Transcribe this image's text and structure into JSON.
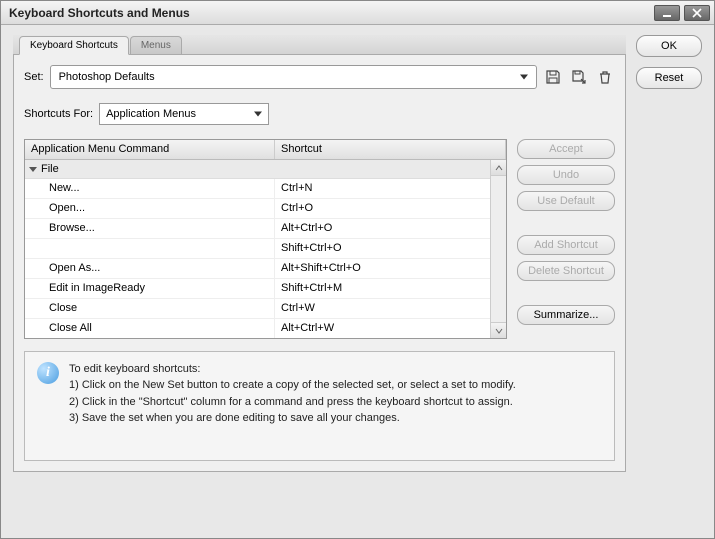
{
  "title": "Keyboard Shortcuts and Menus",
  "dialog": {
    "ok": "OK",
    "reset": "Reset"
  },
  "tabs": {
    "shortcuts": "Keyboard Shortcuts",
    "menus": "Menus"
  },
  "set": {
    "label": "Set:",
    "value": "Photoshop Defaults"
  },
  "shortcuts_for": {
    "label": "Shortcuts For:",
    "value": "Application Menus"
  },
  "table": {
    "headers": {
      "command": "Application Menu Command",
      "shortcut": "Shortcut"
    },
    "group": "File",
    "rows": [
      {
        "cmd": "New...",
        "sc": "Ctrl+N"
      },
      {
        "cmd": "Open...",
        "sc": "Ctrl+O"
      },
      {
        "cmd": "Browse...",
        "sc": "Alt+Ctrl+O"
      },
      {
        "cmd": "",
        "sc": "Shift+Ctrl+O"
      },
      {
        "cmd": "Open As...",
        "sc": "Alt+Shift+Ctrl+O"
      },
      {
        "cmd": "Edit in ImageReady",
        "sc": "Shift+Ctrl+M"
      },
      {
        "cmd": "Close",
        "sc": "Ctrl+W"
      },
      {
        "cmd": "Close All",
        "sc": "Alt+Ctrl+W"
      }
    ]
  },
  "side": {
    "accept": "Accept",
    "undo": "Undo",
    "use_default": "Use Default",
    "add": "Add Shortcut",
    "delete": "Delete Shortcut",
    "summarize": "Summarize..."
  },
  "info": {
    "heading": "To edit keyboard shortcuts:",
    "line1": "1) Click on the New Set button to create a copy of the selected set, or select a set to modify.",
    "line2": "2) Click in the \"Shortcut\" column for a command and press the keyboard shortcut to assign.",
    "line3": "3) Save the set when you are done editing to save all your changes."
  }
}
